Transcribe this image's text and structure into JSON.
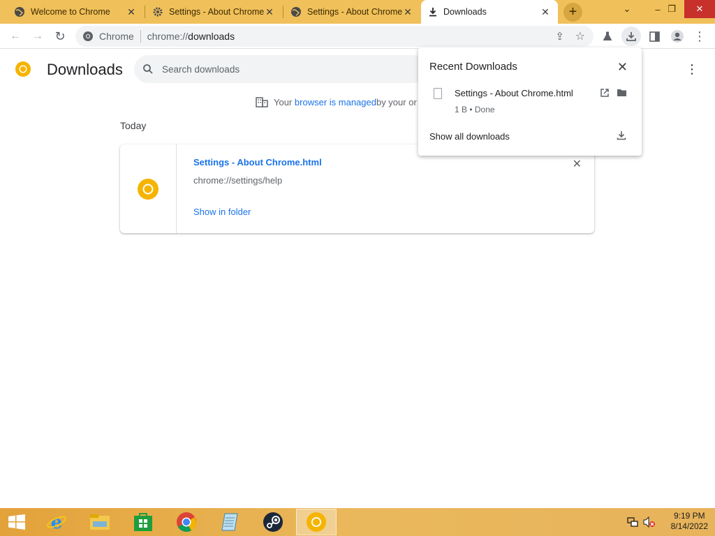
{
  "tabs": [
    {
      "title": "Welcome to Chrome",
      "icon": "globe-icon"
    },
    {
      "title": "Settings - About Chrome",
      "icon": "gear-icon"
    },
    {
      "title": "Settings - About Chrome",
      "icon": "globe-icon"
    },
    {
      "title": "Downloads",
      "icon": "download-icon",
      "active": true
    }
  ],
  "omnibox": {
    "site_label": "Chrome",
    "url_prefix": "chrome://",
    "url_host": "downloads"
  },
  "page": {
    "title": "Downloads",
    "search_placeholder": "Search downloads",
    "managed_prefix": "Your ",
    "managed_link": "browser is managed",
    "managed_suffix": " by your or",
    "section_today": "Today"
  },
  "download_item": {
    "name": "Settings - About Chrome.html",
    "url": "chrome://settings/help",
    "show_in_folder": "Show in folder"
  },
  "popup": {
    "title": "Recent Downloads",
    "file_name": "Settings - About Chrome.html",
    "file_status": "1 B • Done",
    "show_all": "Show all downloads"
  },
  "taskbar": {
    "time": "9:19 PM",
    "date": "8/14/2022",
    "items": [
      "start",
      "internet-explorer",
      "file-explorer",
      "store",
      "chrome",
      "notepad",
      "steam",
      "chrome-canary"
    ]
  },
  "colors": {
    "accent": "#1a73e8",
    "tabstrip": "#f0c05a",
    "taskbar": "#e3a23a"
  }
}
